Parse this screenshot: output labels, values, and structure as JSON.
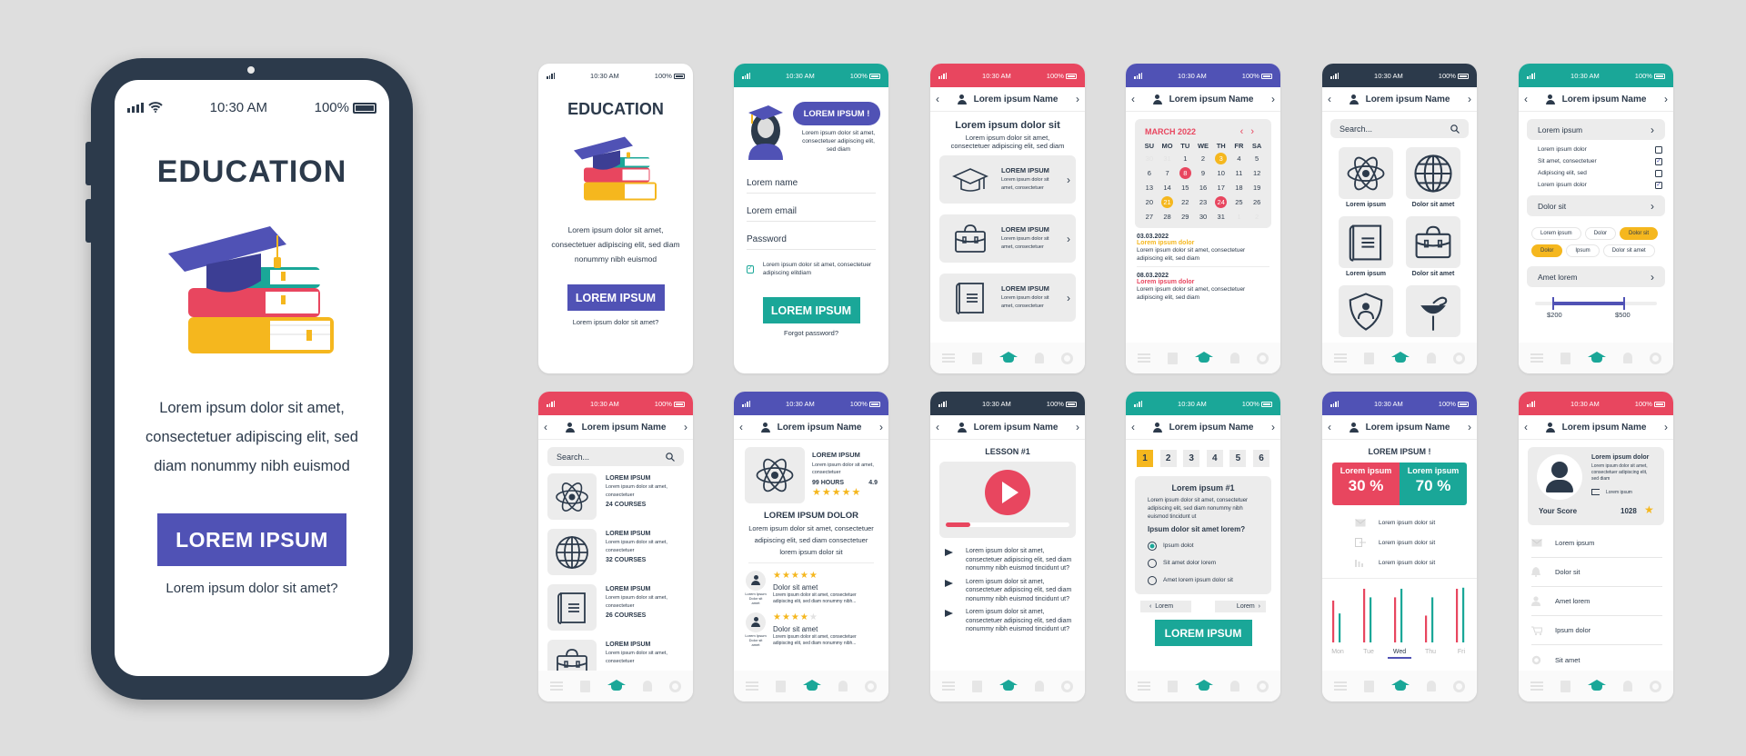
{
  "status": {
    "time": "10:30 AM",
    "battery": "100%"
  },
  "colors": {
    "purple": "#5052b5",
    "teal": "#1aa798",
    "red": "#e8465f",
    "navy": "#2c3a4b",
    "yellow": "#f5b71e"
  },
  "header_name": "Lorem ipsum Name",
  "nav_icons": [
    "menu-icon",
    "book-icon",
    "graduation-cap-icon",
    "bell-icon",
    "gear-icon"
  ],
  "big_phone": {
    "title": "EDUCATION",
    "body_lines": [
      "Lorem ipsum dolor sit amet,",
      "consectetuer adipiscing elit, sed",
      "diam nonummy nibh euismod"
    ],
    "button": "LOREM IPSUM",
    "link": "Lorem ipsum dolor sit amet?"
  },
  "screen_welcome": {
    "title": "EDUCATION",
    "body": "Lorem ipsum dolor sit amet, consectetuer adipiscing elit, sed diam nonummy nibh euismod",
    "button": "LOREM IPSUM",
    "link": "Lorem ipsum dolor sit amet?"
  },
  "screen_signup": {
    "bubble": "LOREM IPSUM !",
    "bubble_text": "Lorem ipsum dolor sit amet, consectetuer adipiscing elit, sed diam",
    "fields": [
      "Lorem name",
      "Lorem email",
      "Password"
    ],
    "checkbox_label": "Lorem ipsum dolor sit amet, consectetuer adipiscing elitdiam",
    "checkbox_checked": true,
    "button": "LOREM IPSUM",
    "link": "Forgot password?"
  },
  "screen_categories": {
    "title": "Lorem ipsum dolor sit",
    "subtitle": "Lorem ipsum dolor sit amet, consectetuer adipiscing elit, sed diam",
    "cards": [
      {
        "icon": "graduation-cap-icon",
        "title": "LOREM IPSUM",
        "text": "Lorem ipsum dolor sit amet, consectetuer"
      },
      {
        "icon": "briefcase-icon",
        "title": "LOREM IPSUM",
        "text": "Lorem ipsum dolor sit amet, consectetuer"
      },
      {
        "icon": "book-icon",
        "title": "LOREM IPSUM",
        "text": "Lorem ipsum dolor sit amet, consectetuer"
      }
    ]
  },
  "screen_calendar": {
    "month": "MARCH 2022",
    "weekdays": [
      "SU",
      "MO",
      "TU",
      "WE",
      "TH",
      "FR",
      "SA"
    ],
    "days": [
      "30",
      "31",
      "1",
      "2",
      "3",
      "4",
      "5",
      "6",
      "7",
      "8",
      "9",
      "10",
      "11",
      "12",
      "13",
      "14",
      "15",
      "16",
      "17",
      "18",
      "19",
      "20",
      "21",
      "22",
      "23",
      "24",
      "25",
      "26",
      "27",
      "28",
      "29",
      "30",
      "31",
      "1",
      "2"
    ],
    "muted_indices": [
      0,
      1,
      33,
      34
    ],
    "highlight_yellow": [
      4,
      22
    ],
    "highlight_red": [
      9,
      25
    ],
    "events": [
      {
        "date": "03.03.2022",
        "title": "Lorem ipsum dolor",
        "color": "#f5b71e",
        "text": "Lorem ipsum dolor sit amet, consectetuer adipiscing elit, sed diam"
      },
      {
        "date": "08.03.2022",
        "title": "Lorem ipsum dolor",
        "color": "#e8465f",
        "text": "Lorem ipsum dolor sit amet, consectetuer adipiscing elit, sed diam"
      }
    ]
  },
  "screen_grid": {
    "search_placeholder": "Search...",
    "items": [
      {
        "icon": "atom-icon",
        "label": "Lorem ipsum"
      },
      {
        "icon": "globe-icon",
        "label": "Dolor sit amet"
      },
      {
        "icon": "book-icon",
        "label": "Lorem ipsum"
      },
      {
        "icon": "briefcase-icon",
        "label": "Dolor sit amet"
      },
      {
        "icon": "shield-user-icon",
        "label": ""
      },
      {
        "icon": "medicine-icon",
        "label": ""
      }
    ]
  },
  "screen_filters": {
    "section1": "Lorem ipsum",
    "checks": [
      {
        "label": "Lorem ipsum dolor",
        "checked": false
      },
      {
        "label": "Sit amet, consectetuer",
        "checked": true
      },
      {
        "label": "Adipiscing elit, sed",
        "checked": false
      },
      {
        "label": "Lorem ipsum dolor",
        "checked": true
      }
    ],
    "section2": "Dolor sit",
    "tags": [
      {
        "label": "Lorem ipsum",
        "active": false
      },
      {
        "label": "Dolor",
        "active": false
      },
      {
        "label": "Dolor sit",
        "active": true
      },
      {
        "label": "Dolor",
        "active": true
      },
      {
        "label": "Ipsum",
        "active": false
      },
      {
        "label": "Dolor sit amet",
        "active": false
      }
    ],
    "section3": "Amet lorem",
    "range_min": "$200",
    "range_max": "$500"
  },
  "screen_courses": {
    "search_placeholder": "Search...",
    "items": [
      {
        "icon": "atom-icon",
        "title": "LOREM IPSUM",
        "text": "Lorem ipsum dolor sit amet, consectetuer",
        "count": "24 COURSES"
      },
      {
        "icon": "globe-icon",
        "title": "LOREM IPSUM",
        "text": "Lorem ipsum dolor sit amet, consectetuer",
        "count": "32 COURSES"
      },
      {
        "icon": "book-icon",
        "title": "LOREM IPSUM",
        "text": "Lorem ipsum dolor sit amet, consectetuer",
        "count": "26 COURSES"
      },
      {
        "icon": "briefcase-icon",
        "title": "LOREM IPSUM",
        "text": "Lorem ipsum dolor sit amet, consectetuer",
        "count": ""
      }
    ]
  },
  "screen_course_detail": {
    "title": "LOREM IPSUM",
    "text": "Lorem ipsum dolor sit amet, consectetuer",
    "hours": "99 HOURS",
    "rating": "4.9",
    "rating_stars": 5,
    "heading": "LOREM IPSUM DOLOR",
    "body": "Lorem ipsum dolor sit amet, consectetuer adipiscing elit, sed diam consectetuer lorem ipsum dolor sit",
    "reviews": [
      {
        "stars": 5,
        "title": "Dolor sit amet",
        "text": "Lorem ipsum dolor sit amet, consectetuer adipiscing elit, sed diam nonummy nibh...",
        "author": "Lorem Ipsum Dolor sit amet"
      },
      {
        "stars": 4,
        "title": "Dolor sit amet",
        "text": "Lorem ipsum dolor sit amet, consectetuer adipiscing elit, sed diam nonummy nibh...",
        "author": "Lorem Ipsum Dolor sit amet"
      }
    ]
  },
  "screen_lesson": {
    "title": "LESSON #1",
    "progress": 0.2,
    "items": [
      "Lorem ipsum dolor sit amet, consectetuer adipiscing elit, sed diam nonummy nibh euismod tincidunt ut?",
      "Lorem ipsum dolor sit amet, consectetuer adipiscing elit, sed diam nonummy nibh euismod tincidunt ut?",
      "Lorem ipsum dolor sit amet, consectetuer adipiscing elit, sed diam nonummy nibh euismod tincidunt ut?"
    ]
  },
  "screen_quiz": {
    "steps": [
      "1",
      "2",
      "3",
      "4",
      "5",
      "6"
    ],
    "active_step": 0,
    "title": "Lorem ipsum #1",
    "text": "Lorem ipsum dolor sit amet, consectetuer adipiscing elit, sed diam nonummy nibh euismod tincidunt ut",
    "question": "Ipsum dolor sit amet lorem?",
    "options": [
      "Ipsum dolot",
      "Sit amet dolor lorem",
      "Amet lorem ipsum dolor sit"
    ],
    "selected": 0,
    "prev": "Lorem",
    "next": "Lorem",
    "button": "LOREM IPSUM"
  },
  "screen_stats": {
    "title": "LOREM IPSUM !",
    "left_label": "Lorem ipsum",
    "left_value": "30 %",
    "right_label": "Lorem ipsum",
    "right_value": "70 %",
    "list": [
      {
        "icon": "mail-icon",
        "label": "Lorem ipsum dolor sit"
      },
      {
        "icon": "logout-icon",
        "label": "Lorem ipsum dolor sit"
      },
      {
        "icon": "bar-chart-icon",
        "label": "Lorem ipsum dolor sit"
      }
    ],
    "active_day": 2
  },
  "chart_data": {
    "type": "bar",
    "title": "",
    "categories": [
      "Mon",
      "Tue",
      "Wed",
      "Thu",
      "Fri"
    ],
    "series": [
      {
        "name": "red",
        "color": "#e8465f",
        "values": [
          0.78,
          1.0,
          0.84,
          0.5,
          1.0
        ]
      },
      {
        "name": "teal",
        "color": "#1aa798",
        "values": [
          0.54,
          0.84,
          1.0,
          0.84,
          1.02
        ]
      }
    ],
    "xlabel": "",
    "ylabel": "",
    "ylim": [
      0,
      1.05
    ],
    "grid": false,
    "legend": "none"
  },
  "screen_profile": {
    "title": "Lorem ipsum dolor",
    "text": "Lorem ipsum dolor sit amet, consectetuer adipiscing elit, sed diam",
    "action": "Lorem ipsum",
    "score_label": "Your Score",
    "score": "1028",
    "menu": [
      {
        "icon": "mail-icon",
        "label": "Lorem ipsum"
      },
      {
        "icon": "bell-icon",
        "label": "Dolor sit"
      },
      {
        "icon": "user-icon",
        "label": "Amet lorem"
      },
      {
        "icon": "cart-icon",
        "label": "Ipsum dolor"
      },
      {
        "icon": "gear-icon",
        "label": "Sit amet"
      }
    ]
  }
}
